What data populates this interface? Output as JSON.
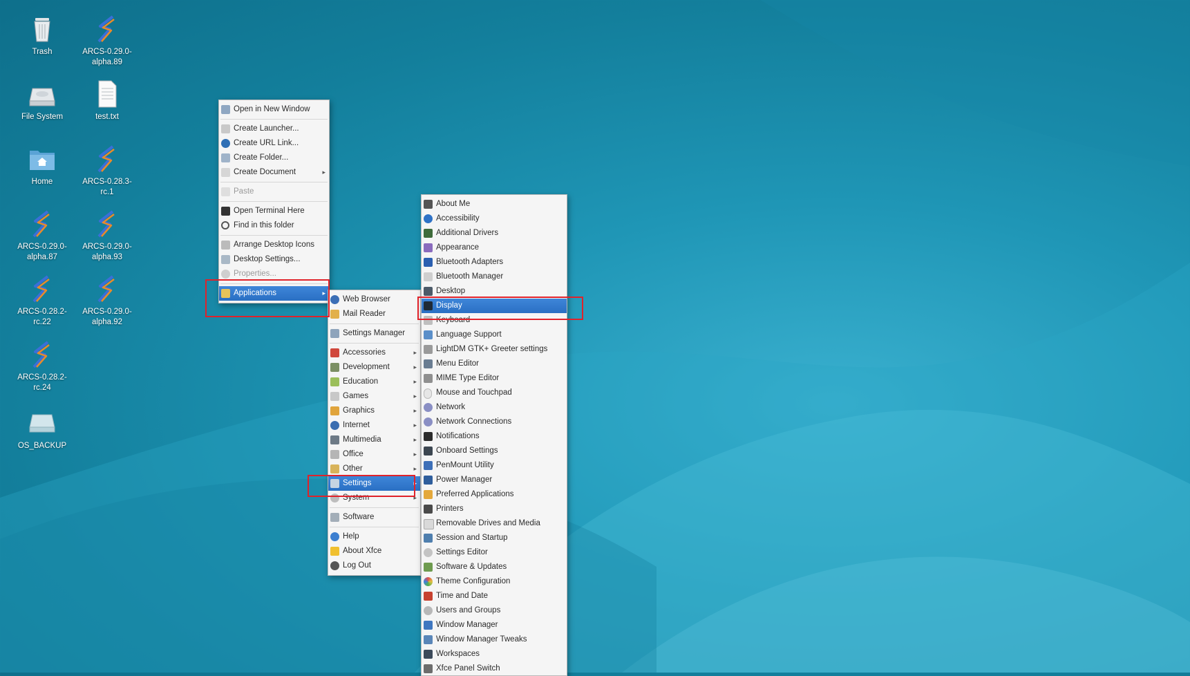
{
  "desktop": {
    "icons": [
      {
        "label": "Trash",
        "icon": "trash-icon"
      },
      {
        "label": "ARCS-0.29.0-alpha.89",
        "icon": "arcs-app-icon"
      },
      {
        "label": "File System",
        "icon": "drive-icon"
      },
      {
        "label": "test.txt",
        "icon": "text-file-icon"
      },
      {
        "label": "Home",
        "icon": "home-folder-icon"
      },
      {
        "label": "ARCS-0.28.3-rc.1",
        "icon": "arcs-app-icon"
      },
      {
        "label": "ARCS-0.29.0-alpha.87",
        "icon": "arcs-app-icon"
      },
      {
        "label": "ARCS-0.29.0-alpha.93",
        "icon": "arcs-app-icon"
      },
      {
        "label": "ARCS-0.28.2-rc.22",
        "icon": "arcs-app-icon"
      },
      {
        "label": "ARCS-0.29.0-alpha.92",
        "icon": "arcs-app-icon"
      },
      {
        "label": "ARCS-0.28.2-rc.24",
        "icon": "arcs-app-icon"
      },
      {
        "label": "OS_BACKUP",
        "icon": "drive-icon"
      }
    ]
  },
  "desktop_menu": {
    "open_new_window": "Open in New Window",
    "create_launcher": "Create Launcher...",
    "create_url_link": "Create URL Link...",
    "create_folder": "Create Folder...",
    "create_document": "Create Document",
    "paste": "Paste",
    "open_terminal": "Open Terminal Here",
    "find_in_folder": "Find in this folder",
    "arrange_icons": "Arrange Desktop Icons",
    "desktop_settings": "Desktop Settings...",
    "properties": "Properties...",
    "applications": "Applications"
  },
  "apps_menu": {
    "web_browser": "Web Browser",
    "mail_reader": "Mail Reader",
    "settings_manager": "Settings Manager",
    "accessories": "Accessories",
    "development": "Development",
    "education": "Education",
    "games": "Games",
    "graphics": "Graphics",
    "internet": "Internet",
    "multimedia": "Multimedia",
    "office": "Office",
    "other": "Other",
    "settings": "Settings",
    "system": "System",
    "software": "Software",
    "help": "Help",
    "about_xfce": "About Xfce",
    "log_out": "Log Out"
  },
  "settings_menu": {
    "items": [
      "About Me",
      "Accessibility",
      "Additional Drivers",
      "Appearance",
      "Bluetooth Adapters",
      "Bluetooth Manager",
      "Desktop",
      "Display",
      "Keyboard",
      "Language Support",
      "LightDM GTK+ Greeter settings",
      "Menu Editor",
      "MIME Type Editor",
      "Mouse and Touchpad",
      "Network",
      "Network Connections",
      "Notifications",
      "Onboard Settings",
      "PenMount Utility",
      "Power Manager",
      "Preferred Applications",
      "Printers",
      "Removable Drives and Media",
      "Session and Startup",
      "Settings Editor",
      "Software & Updates",
      "Theme Configuration",
      "Time and Date",
      "Users and Groups",
      "Window Manager",
      "Window Manager Tweaks",
      "Workspaces",
      "Xfce Panel Switch"
    ],
    "selected": "Display"
  },
  "colors": {
    "selection": "#2f76cc",
    "highlight_box": "#e0222a",
    "wallpaper": "#1b8fb0"
  }
}
